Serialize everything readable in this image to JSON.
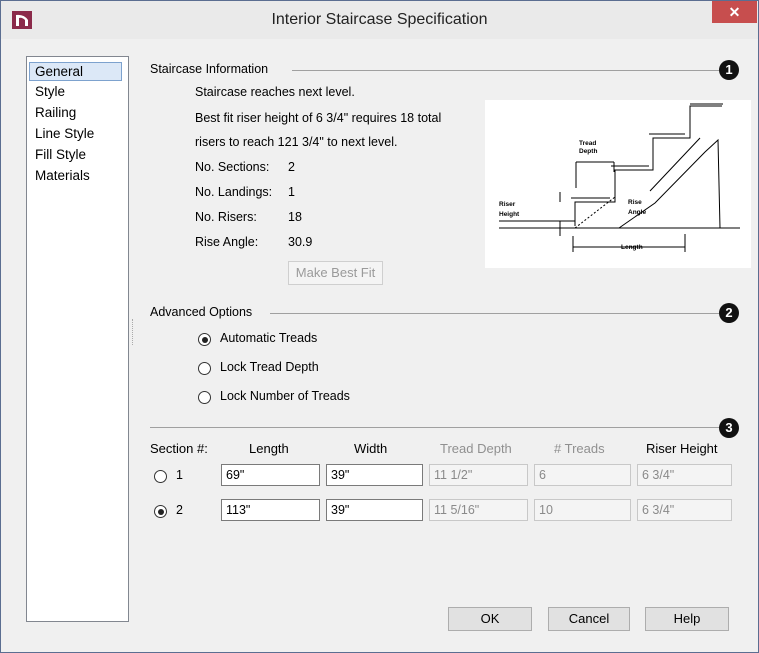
{
  "window": {
    "title": "Interior Staircase Specification",
    "close_label": "✕"
  },
  "sidebar": {
    "items": [
      "General",
      "Style",
      "Railing",
      "Line Style",
      "Fill Style",
      "Materials"
    ],
    "selected": "General"
  },
  "staircase_info": {
    "heading": "Staircase Information",
    "badge": "1",
    "lines": [
      "Staircase reaches next level.",
      "Best fit riser height of 6 3/4\" requires 18 total",
      "risers to reach 121 3/4\" to next level."
    ],
    "sections_label": "No. Sections:",
    "sections_value": "2",
    "landings_label": "No. Landings:",
    "landings_value": "1",
    "risers_label": "No. Risers:",
    "risers_value": "18",
    "angle_label": "Rise Angle:",
    "angle_value": "30.9",
    "best_fit_button": "Make Best Fit"
  },
  "diagram": {
    "tread_depth": [
      "Tread",
      "Depth"
    ],
    "riser_height": [
      "Riser",
      "Height"
    ],
    "rise_angle": [
      "Rise",
      "Angle"
    ],
    "length": "Length"
  },
  "advanced": {
    "heading": "Advanced Options",
    "badge": "2",
    "options": [
      "Automatic Treads",
      "Lock Tread Depth",
      "Lock Number of Treads"
    ],
    "selected_index": 0
  },
  "sections": {
    "badge": "3",
    "headers": [
      "Section #:",
      "Length",
      "Width",
      "Tread Depth",
      "# Treads",
      "Riser Height"
    ],
    "rows": [
      {
        "num": "1",
        "length": "69\"",
        "width": "39\"",
        "tread_depth": "11 1/2\"",
        "treads": "6",
        "riser_height": "6 3/4\"",
        "selected": false
      },
      {
        "num": "2",
        "length": "113\"",
        "width": "39\"",
        "tread_depth": "11 5/16\"",
        "treads": "10",
        "riser_height": "6 3/4\"",
        "selected": true
      }
    ]
  },
  "buttons": {
    "ok": "OK",
    "cancel": "Cancel",
    "help": "Help"
  },
  "colors": {
    "app_icon": "#8b2a4a",
    "close_button": "#c74e4e",
    "selection": "#dce8f7",
    "badge": "#111111"
  }
}
